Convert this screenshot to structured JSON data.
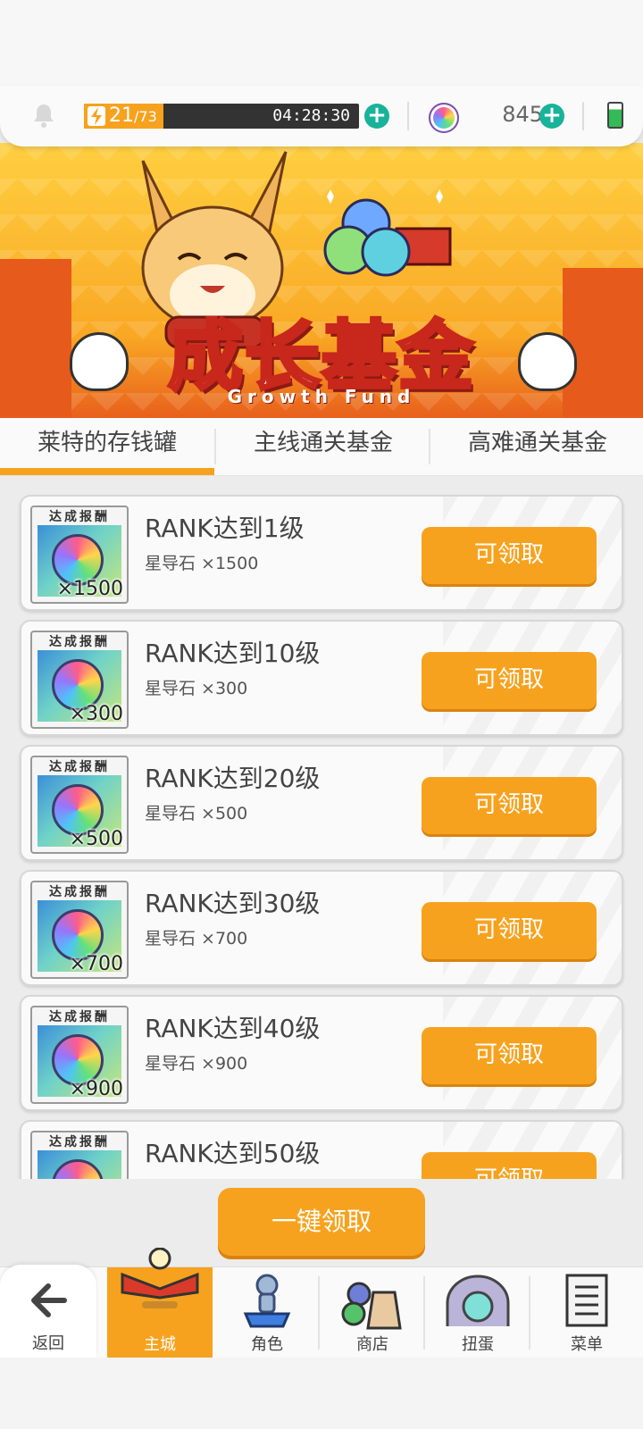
{
  "topbar": {
    "stamina_current": "21",
    "stamina_max": "/73",
    "stamina_fraction": 0.29,
    "timer": "04:28:30",
    "plus_label": "+",
    "gem_count": "845"
  },
  "banner": {
    "title": "成长基金",
    "subtitle": "Growth Fund"
  },
  "tabs": [
    {
      "label": "莱特的存钱罐"
    },
    {
      "label": "主线通关基金"
    },
    {
      "label": "高难通关基金"
    }
  ],
  "reward_header": "达成报酬",
  "claim_label": "可领取",
  "items": [
    {
      "title": "RANK达到1级",
      "reward": "星导石 ×1500",
      "qty": "×1500"
    },
    {
      "title": "RANK达到10级",
      "reward": "星导石 ×300",
      "qty": "×300"
    },
    {
      "title": "RANK达到20级",
      "reward": "星导石 ×500",
      "qty": "×500"
    },
    {
      "title": "RANK达到30级",
      "reward": "星导石 ×700",
      "qty": "×700"
    },
    {
      "title": "RANK达到40级",
      "reward": "星导石 ×900",
      "qty": "×900"
    },
    {
      "title": "RANK达到50级",
      "reward": "",
      "qty": ""
    }
  ],
  "one_click_label": "一键领取",
  "nav": {
    "back": "返回",
    "main_city": "主城",
    "character": "角色",
    "shop": "商店",
    "gacha": "扭蛋",
    "menu": "菜单"
  },
  "colors": {
    "accent": "#f7a21e",
    "teal": "#17b39a",
    "banner_red": "#c8271b"
  }
}
